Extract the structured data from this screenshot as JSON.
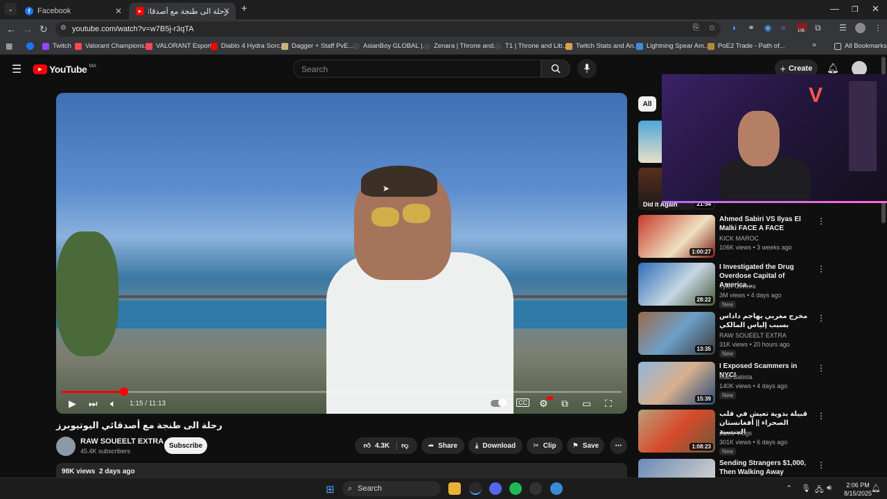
{
  "tabs": [
    {
      "title": "Facebook",
      "favicon_color": "#1877f2"
    },
    {
      "title": "رحلة الى طنجة مع أصدقائي اليو",
      "favicon_color": "#ff0000"
    }
  ],
  "address": {
    "url": "youtube.com/watch?v=w7B5j-r3qTA"
  },
  "bookmarks": [
    "Twitch",
    "Valorant Champions...",
    "VALORANT Esports",
    "Diablo 4 Hydra Sorc...",
    "Dagger + Staff PvE...",
    "AsianBoy GLOBAL |...",
    "Zenara | Throne and...",
    "T1 | Throne and Lib...",
    "Twitch Stats and An...",
    "Lightning Spear Am...",
    "PoE2 Trade - Path of..."
  ],
  "all_bookmarks_label": "All Bookmarks",
  "extension_badge": "106",
  "yt": {
    "logo": "YouTube",
    "region": "MA",
    "search_placeholder": "Search",
    "create_label": "Create"
  },
  "video": {
    "time": "1:15 / 11:13",
    "progress": 0.111,
    "title": "رحلة الى طنجة مع أصدقائي اليوتيوبرز",
    "channel": "RAW SOUEELT EXTRA",
    "subscribers": "45.4K subscribers",
    "subscribe_label": "Subscribe",
    "likes": "4.3K",
    "share_label": "Share",
    "download_label": "Download",
    "clip_label": "Clip",
    "save_label": "Save",
    "views": "98K views",
    "age": "2 days ago"
  },
  "sidebar": {
    "chip_all": "All",
    "partial_top": [
      {
        "text": "Did it Again",
        "duration": "21:54"
      }
    ],
    "recommendations": [
      {
        "title": "Ahmed Sabiri VS Ilyas El Malki FACE A FACE",
        "channel": "KICK MAROC",
        "meta": "106K views • 3 weeks ago",
        "duration": "1:00:27",
        "is_new": false
      },
      {
        "title": "I Investigated the Drug Overdose Capital of America...",
        "channel": "Tyler Oliveira",
        "meta": "3M views • 4 days ago",
        "duration": "28:22",
        "is_new": true
      },
      {
        "title": "مخرج مغربي يهاجم داداس بسبب إلياس المالكي",
        "channel": "RAW SOUEELT EXTRA",
        "meta": "31K views • 20 hours ago",
        "duration": "13:35",
        "is_new": true
      },
      {
        "title": "I Exposed Scammers in NYC!",
        "channel": "Matt Batista",
        "meta": "140K views • 4 days ago",
        "duration": "15:39",
        "is_new": true
      },
      {
        "title": "قبيلة بدوية تعيش في قلب الصحراء || أفغانستان المنسية",
        "channel": "Zizou Vlogs",
        "meta": "301K views • 6 days ago",
        "duration": "1:08:23",
        "is_new": true
      },
      {
        "title": "Sending Strangers $1,000, Then Walking Away",
        "channel": "",
        "meta": "",
        "duration": "",
        "is_new": false
      }
    ],
    "new_label": "New"
  },
  "taskbar": {
    "search_label": "Search",
    "time": "2:06 PM",
    "date": "8/15/2025"
  }
}
